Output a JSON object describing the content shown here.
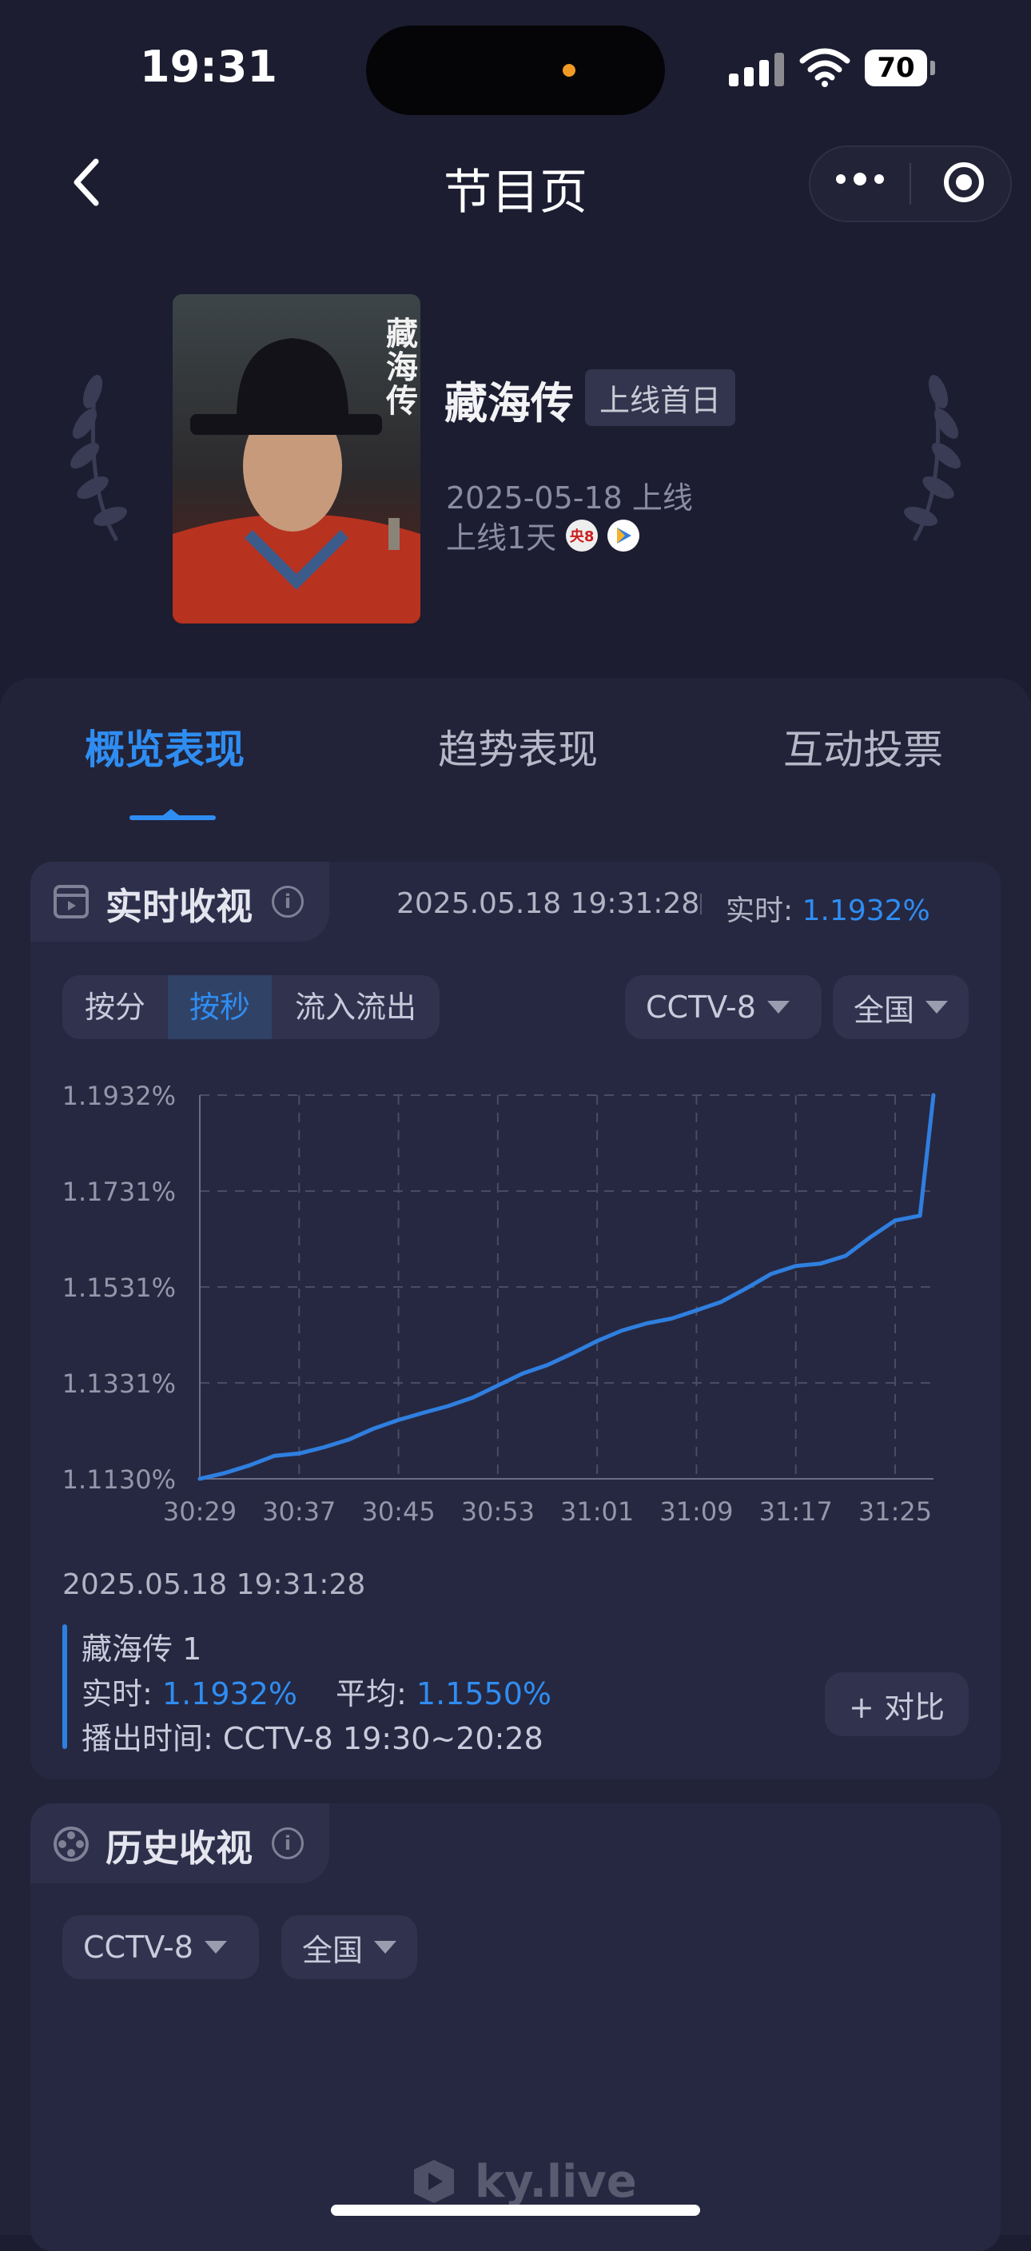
{
  "status_bar": {
    "time": "19:31",
    "battery": "70"
  },
  "nav": {
    "title": "节目页"
  },
  "show": {
    "title": "藏海传",
    "badge": "上线首日",
    "release": "2025-05-18 上线",
    "online_days": "上线1天",
    "channel_chip": "央8",
    "poster_text": "藏海传"
  },
  "tabs": [
    {
      "label": "概览表现",
      "active": true
    },
    {
      "label": "趋势表现",
      "active": false
    },
    {
      "label": "互动投票",
      "active": false
    }
  ],
  "realtime": {
    "title": "实时收视",
    "timestamp": "2025.05.18 19:31:28",
    "realtime_label": "实时:",
    "realtime_value": "1.1932%",
    "modes": [
      {
        "label": "按分",
        "active": false
      },
      {
        "label": "按秒",
        "active": true
      },
      {
        "label": "流入流出",
        "active": false
      }
    ],
    "channel_select": "CCTV-8",
    "region_select": "全国",
    "detail": {
      "timestamp": "2025.05.18 19:31:28",
      "episode": "藏海传 1",
      "realtime_label": "实时:",
      "realtime_value": "1.1932%",
      "average_label": "平均:",
      "average_value": "1.1550%",
      "airtime": "播出时间: CCTV-8 19:30~20:28"
    },
    "compare_button": "+ 对比"
  },
  "chart_data": {
    "type": "line",
    "x": [
      "30:29",
      "30:37",
      "30:45",
      "30:53",
      "31:01",
      "31:09",
      "31:17",
      "31:25"
    ],
    "y_ticks": [
      "1.1932%",
      "1.1731%",
      "1.1531%",
      "1.1331%",
      "1.1130%"
    ],
    "ylim": [
      1.113,
      1.1932
    ],
    "grid": true,
    "accent_color": "#2f7fe0",
    "series": [
      {
        "points": [
          [
            "30:29",
            1.113
          ],
          [
            "30:31",
            1.1142
          ],
          [
            "30:33",
            1.1158
          ],
          [
            "30:35",
            1.1178
          ],
          [
            "30:37",
            1.1183
          ],
          [
            "30:39",
            1.1196
          ],
          [
            "30:41",
            1.1212
          ],
          [
            "30:43",
            1.1235
          ],
          [
            "30:45",
            1.1253
          ],
          [
            "30:47",
            1.1268
          ],
          [
            "30:49",
            1.1282
          ],
          [
            "30:51",
            1.13
          ],
          [
            "30:53",
            1.1325
          ],
          [
            "30:55",
            1.135
          ],
          [
            "30:57",
            1.1368
          ],
          [
            "30:59",
            1.1392
          ],
          [
            "31:01",
            1.1418
          ],
          [
            "31:03",
            1.144
          ],
          [
            "31:05",
            1.1455
          ],
          [
            "31:07",
            1.1465
          ],
          [
            "31:09",
            1.1482
          ],
          [
            "31:11",
            1.15
          ],
          [
            "31:13",
            1.1528
          ],
          [
            "31:15",
            1.1558
          ],
          [
            "31:17",
            1.1575
          ],
          [
            "31:19",
            1.158
          ],
          [
            "31:21",
            1.1596
          ],
          [
            "31:23",
            1.1635
          ],
          [
            "31:25",
            1.167
          ],
          [
            "31:27",
            1.168
          ],
          [
            "31:28",
            1.1932
          ]
        ]
      }
    ]
  },
  "history": {
    "title": "历史收视",
    "channel_select": "CCTV-8",
    "region_select": "全国"
  },
  "watermark": "ky.live"
}
